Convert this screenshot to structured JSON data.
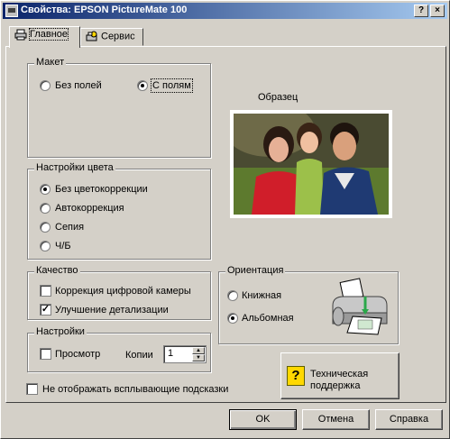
{
  "window": {
    "title": "Свойства: EPSON PictureMate 100",
    "help_button": "?",
    "close_button": "×"
  },
  "tabs": [
    {
      "label": "Главное",
      "active": true
    },
    {
      "label": "Сервис",
      "active": false
    }
  ],
  "maket": {
    "legend": "Макет",
    "options": [
      {
        "label": "Без полей",
        "selected": false
      },
      {
        "label": "С полям",
        "selected": true
      }
    ]
  },
  "preview": {
    "label": "Образец"
  },
  "color": {
    "legend": "Настройки цвета",
    "options": [
      {
        "label": "Без цветокоррекции",
        "selected": true
      },
      {
        "label": "Автокоррекция",
        "selected": false
      },
      {
        "label": "Сепия",
        "selected": false
      },
      {
        "label": "Ч/Б",
        "selected": false
      }
    ]
  },
  "quality": {
    "legend": "Качество",
    "options": [
      {
        "label": "Коррекция цифровой камеры",
        "checked": false
      },
      {
        "label": "Улучшение детализации",
        "checked": true
      }
    ]
  },
  "orientation": {
    "legend": "Ориентация",
    "options": [
      {
        "label": "Книжная",
        "selected": false
      },
      {
        "label": "Альбомная",
        "selected": true
      }
    ]
  },
  "settings": {
    "legend": "Настройки",
    "preview_label": "Просмотр",
    "preview_checked": false,
    "copies_label": "Копии",
    "copies_value": "1"
  },
  "support_button": {
    "line1": "Техническая",
    "line2": "поддержка"
  },
  "hide_tips": {
    "label": "Не отображать всплывающие подсказки",
    "checked": false
  },
  "footer": {
    "ok": "OK",
    "cancel": "Отмена",
    "help": "Справка"
  },
  "colors": {
    "titlebar_start": "#0a246a",
    "titlebar_end": "#a6caf0",
    "dialog_bg": "#d4d0c8"
  },
  "icons": {
    "tab_main": "printer-icon",
    "tab_service": "maintenance-icon",
    "orientation": "landscape-printer-icon",
    "support": "question-mark-icon"
  }
}
